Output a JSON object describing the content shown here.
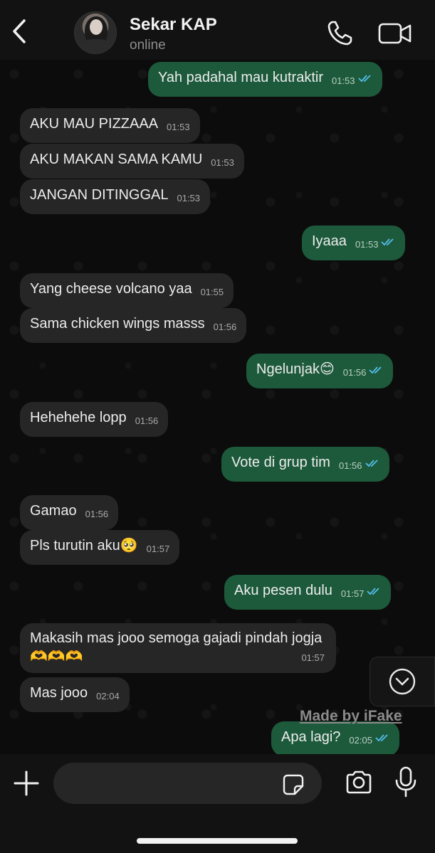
{
  "header": {
    "name": "Sekar KAP",
    "status": "online"
  },
  "messages": [
    {
      "dir": "out",
      "text": "Yah padahal mau kutraktir",
      "time": "01:53",
      "read": true
    },
    {
      "dir": "in",
      "text": "AKU MAU PIZZAAA",
      "time": "01:53"
    },
    {
      "dir": "in",
      "text": "AKU MAKAN SAMA KAMU",
      "time": "01:53"
    },
    {
      "dir": "in",
      "text": "JANGAN DITINGGAL",
      "time": "01:53"
    },
    {
      "dir": "out",
      "text": "Iyaaa",
      "time": "01:53",
      "read": true
    },
    {
      "dir": "in",
      "text": "Yang cheese volcano yaa",
      "time": "01:55"
    },
    {
      "dir": "in",
      "text": "Sama chicken wings masss",
      "time": "01:56"
    },
    {
      "dir": "out",
      "text": "Ngelunjak😊",
      "time": "01:56",
      "read": true
    },
    {
      "dir": "in",
      "text": "Hehehehe lopp",
      "time": "01:56"
    },
    {
      "dir": "out",
      "text": "Vote di grup tim",
      "time": "01:56",
      "read": true
    },
    {
      "dir": "in",
      "text": "Gamao",
      "time": "01:56"
    },
    {
      "dir": "in",
      "text": "Pls turutin aku🥺",
      "time": "01:57"
    },
    {
      "dir": "out",
      "text": "Aku pesen dulu",
      "time": "01:57",
      "read": true
    },
    {
      "dir": "in",
      "text": "Makasih mas jooo semoga gajadi pindah jogja🫶🫶🫶",
      "time": "01:57"
    },
    {
      "dir": "in",
      "text": "Mas jooo",
      "time": "02:04"
    },
    {
      "dir": "out",
      "text": "Apa lagi?",
      "time": "02:05",
      "read": true
    }
  ],
  "watermark": "Made by iFake",
  "composer": {
    "placeholder": ""
  },
  "colors": {
    "incoming_bubble": "#262626",
    "outgoing_bubble": "#1d5a3b",
    "read_ticks": "#53bdeb"
  },
  "icons": [
    "back-icon",
    "phone-icon",
    "video-camera-icon",
    "chevron-down-icon",
    "plus-icon",
    "sticker-icon",
    "camera-icon",
    "microphone-icon"
  ]
}
